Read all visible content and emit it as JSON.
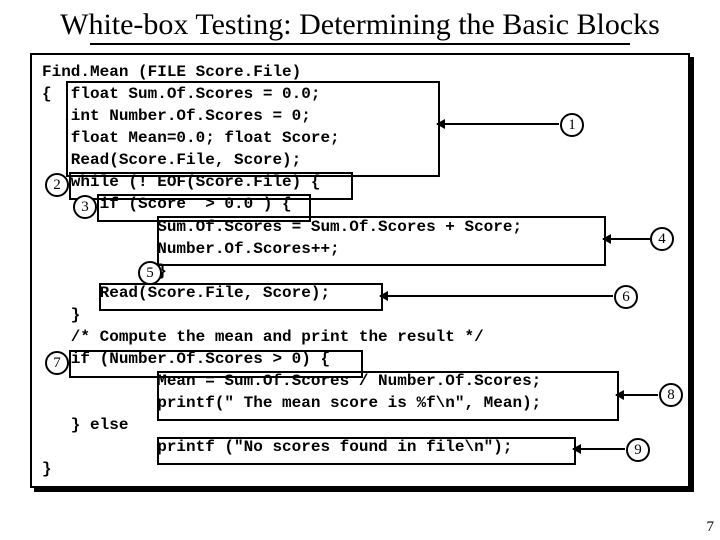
{
  "title": "White-box Testing: Determining the Basic Blocks",
  "code": {
    "l1": "Find.Mean (FILE Score.File)",
    "l2": "{  float Sum.Of.Scores = 0.0;",
    "l3": "   int Number.Of.Scores = 0;",
    "l4": "   float Mean=0.0; float Score;",
    "l5": "   Read(Score.File, Score);",
    "l6": "   while (! EOF(Score.File) {",
    "l7": "      if (Score  > 0.0 ) {",
    "l8": "            Sum.Of.Scores = Sum.Of.Scores + Score;",
    "l9": "            Number.Of.Scores++;",
    "l10": "            }",
    "l11": "      Read(Score.File, Score);",
    "l12": "   }",
    "l13": "   /* Compute the mean and print the result */",
    "l14": "   if (Number.Of.Scores > 0) {",
    "l15": "            Mean = Sum.Of.Scores / Number.Of.Scores;",
    "l16": "            printf(\" The mean score is %f\\n\", Mean);",
    "l17": "   } else",
    "l18": "            printf (\"No scores found in file\\n\");",
    "l19": "}"
  },
  "labels": {
    "n1": "1",
    "n2": "2",
    "n3": "3",
    "n4": "4",
    "n5": "5",
    "n6": "6",
    "n7": "7",
    "n8": "8",
    "n9": "9"
  },
  "page": "7"
}
